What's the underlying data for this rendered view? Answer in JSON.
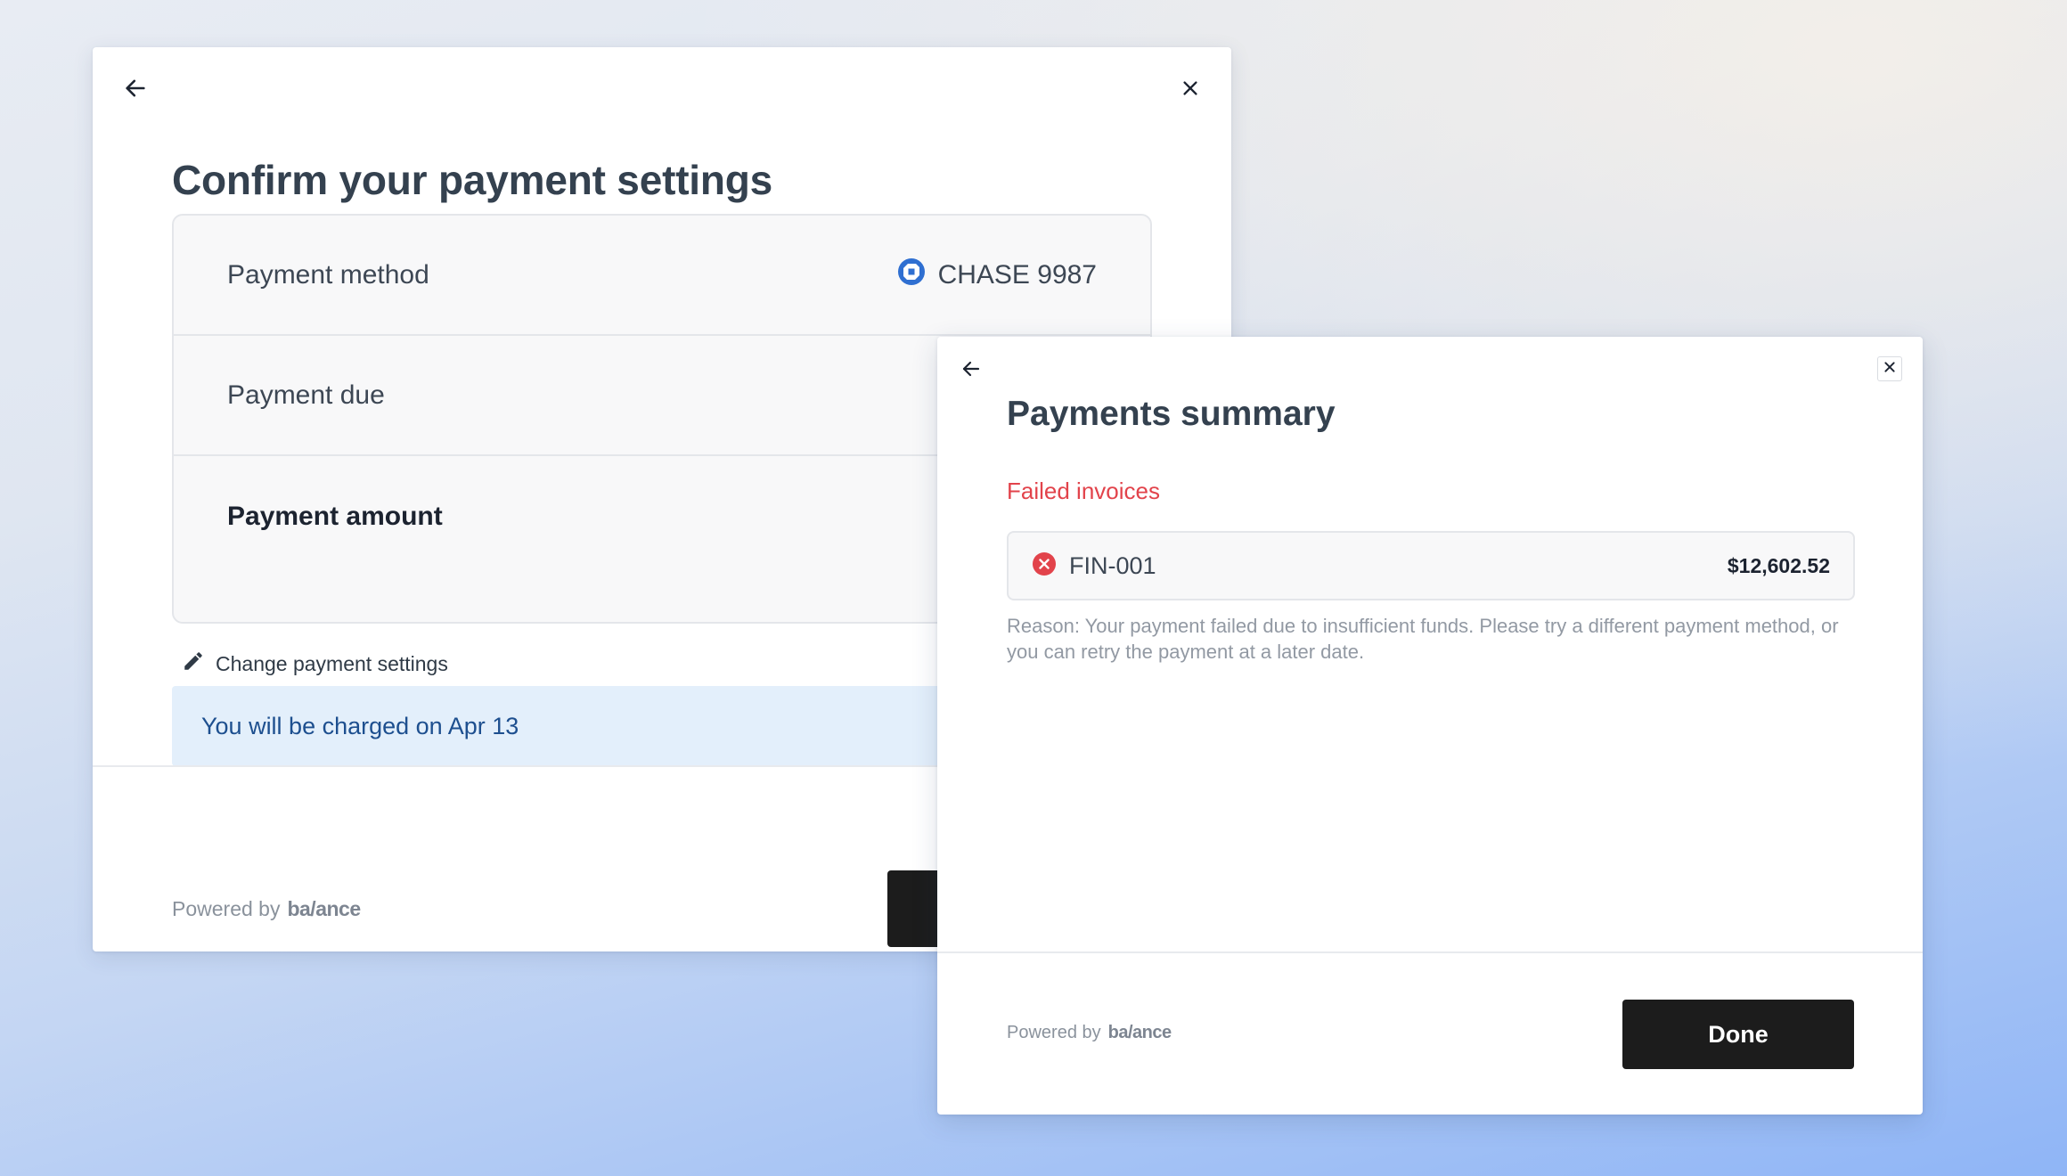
{
  "colors": {
    "primary_button": "#1c1c1c",
    "banner_background": "#e3effb",
    "banner_text": "#1d4f8f",
    "error": "#e2434b",
    "bank_icon": "#2f6fd1"
  },
  "confirm_dialog": {
    "back_icon": "arrow-left-icon",
    "close_icon": "close-icon",
    "title": "Confirm your payment settings",
    "rows": [
      {
        "label": "Payment method",
        "value": "CHASE 9987",
        "value_icon": "chase-bank-icon"
      },
      {
        "label": "Payment due"
      },
      {
        "label": "Payment amount"
      }
    ],
    "change_link": {
      "icon": "pencil-icon",
      "label": "Change payment settings"
    },
    "banner_text": "You will be charged on Apr 13",
    "powered_by": "Powered by",
    "brand": "ba/ance"
  },
  "summary_dialog": {
    "back_icon": "arrow-left-icon",
    "close_icon": "close-icon",
    "title": "Payments summary",
    "failed_heading": "Failed invoices",
    "invoice": {
      "status_icon": "error-x-icon",
      "id": "FIN-001",
      "amount": "$12,602.52"
    },
    "reason": "Reason: Your payment failed due to insufficient funds. Please try a different payment method, or you can retry the payment at a later date.",
    "powered_by": "Powered by",
    "brand": "ba/ance",
    "done_label": "Done"
  }
}
